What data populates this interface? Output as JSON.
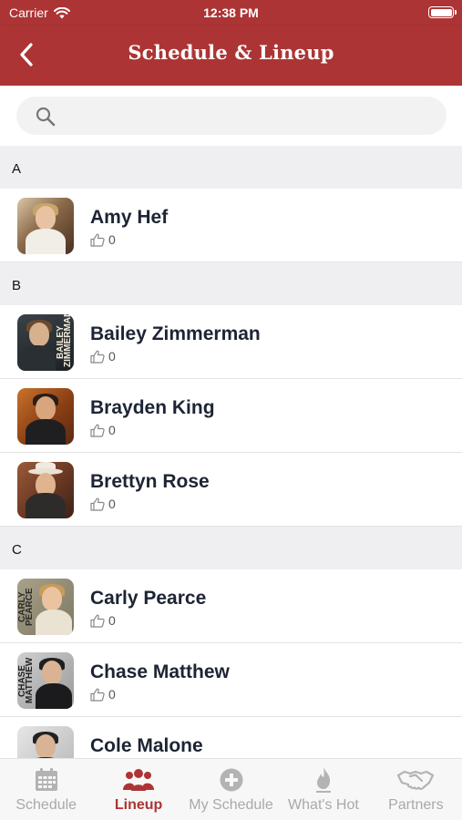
{
  "status_bar": {
    "carrier": "Carrier",
    "time": "12:38 PM"
  },
  "nav": {
    "title": "Schedule & Lineup",
    "back_icon": "chevron-left-icon"
  },
  "search": {
    "placeholder": "",
    "icon": "search-icon"
  },
  "colors": {
    "brand": "#ad3434",
    "section_bg": "#efeff1",
    "tab_inactive": "#a9a9a9"
  },
  "sections": [
    {
      "letter": "A",
      "artists": [
        {
          "name": "Amy Hef",
          "likes": "0"
        }
      ]
    },
    {
      "letter": "B",
      "artists": [
        {
          "name": "Bailey Zimmerman",
          "likes": "0",
          "photo_text": "BAILEY ZIMMERMAN"
        },
        {
          "name": "Brayden King",
          "likes": "0"
        },
        {
          "name": "Brettyn Rose",
          "likes": "0"
        }
      ]
    },
    {
      "letter": "C",
      "artists": [
        {
          "name": "Carly Pearce",
          "likes": "0",
          "photo_text": "CARLY PEARCE"
        },
        {
          "name": "Chase Matthew",
          "likes": "0",
          "photo_text": "CHASE MATTHEW"
        },
        {
          "name": "Cole Malone",
          "likes": ""
        }
      ]
    }
  ],
  "tabs": [
    {
      "label": "Schedule",
      "icon": "calendar-icon",
      "active": false
    },
    {
      "label": "Lineup",
      "icon": "people-group-icon",
      "active": true
    },
    {
      "label": "My Schedule",
      "icon": "plus-circle-icon",
      "active": false
    },
    {
      "label": "What's Hot",
      "icon": "flame-icon",
      "active": false
    },
    {
      "label": "Partners",
      "icon": "handshake-icon",
      "active": false
    }
  ]
}
